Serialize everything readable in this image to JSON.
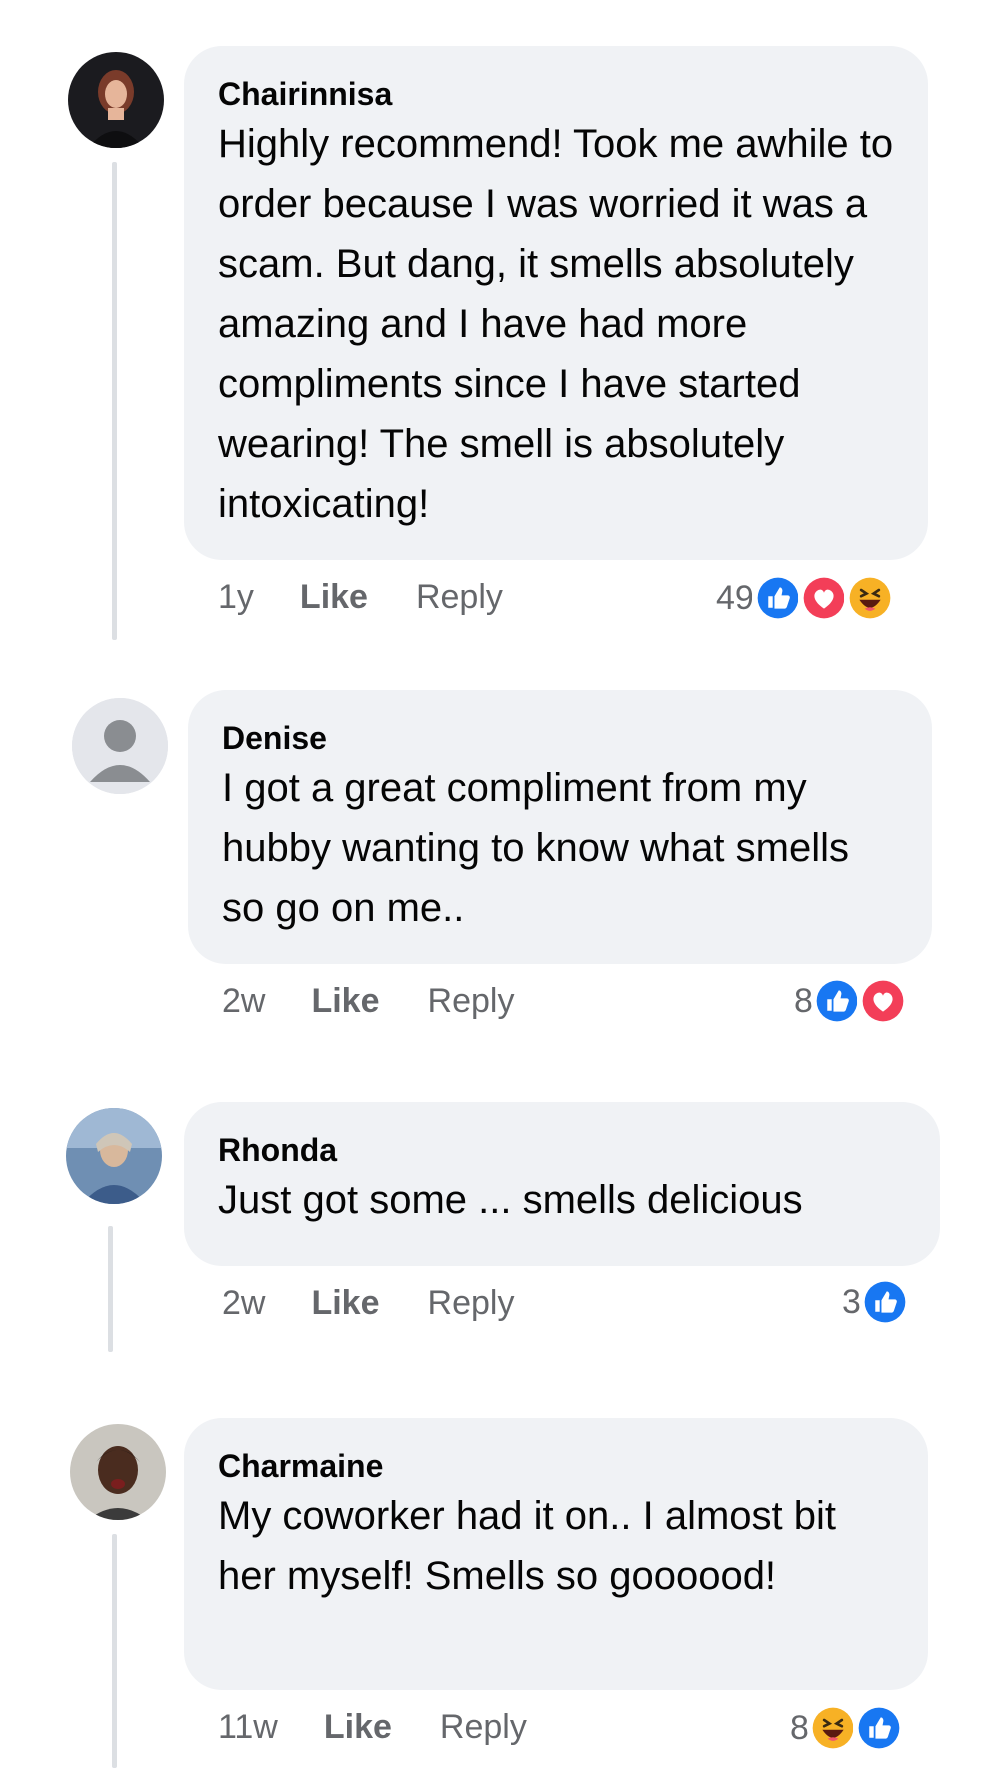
{
  "comments": [
    {
      "author": "Chairinnisa",
      "text": "Highly recommend! Took me awhile to order because I was worried it was a scam. But dang, it smells absolutely amazing and I have had more compliments since I have started wearing! The smell is absolutely intoxicating!",
      "time": "1y",
      "like_label": "Like",
      "reply_label": "Reply",
      "reaction_count": "49",
      "reactions": [
        "like-icon",
        "love-icon",
        "haha-icon"
      ]
    },
    {
      "author": "Denise",
      "text": "I got a great compliment from my hubby wanting to know what smells so go on me..",
      "time": "2w",
      "like_label": "Like",
      "reply_label": "Reply",
      "reaction_count": "8",
      "reactions": [
        "like-icon",
        "love-icon"
      ]
    },
    {
      "author": "Rhonda",
      "text": "Just got some ... smells delicious",
      "time": "2w",
      "like_label": "Like",
      "reply_label": "Reply",
      "reaction_count": "3",
      "reactions": [
        "like-icon"
      ]
    },
    {
      "author": "Charmaine",
      "text": "My coworker had it on.. I almost bit her myself! Smells so goooood!",
      "time": "11w",
      "like_label": "Like",
      "reply_label": "Reply",
      "reaction_count": "8",
      "reactions": [
        "haha-icon",
        "like-icon"
      ]
    }
  ],
  "colors": {
    "bubble": "#f0f2f5",
    "secondary_text": "#65676b",
    "like_blue": "#1877f2",
    "love_red": "#f33e58",
    "haha_yellow": "#f7b125"
  }
}
